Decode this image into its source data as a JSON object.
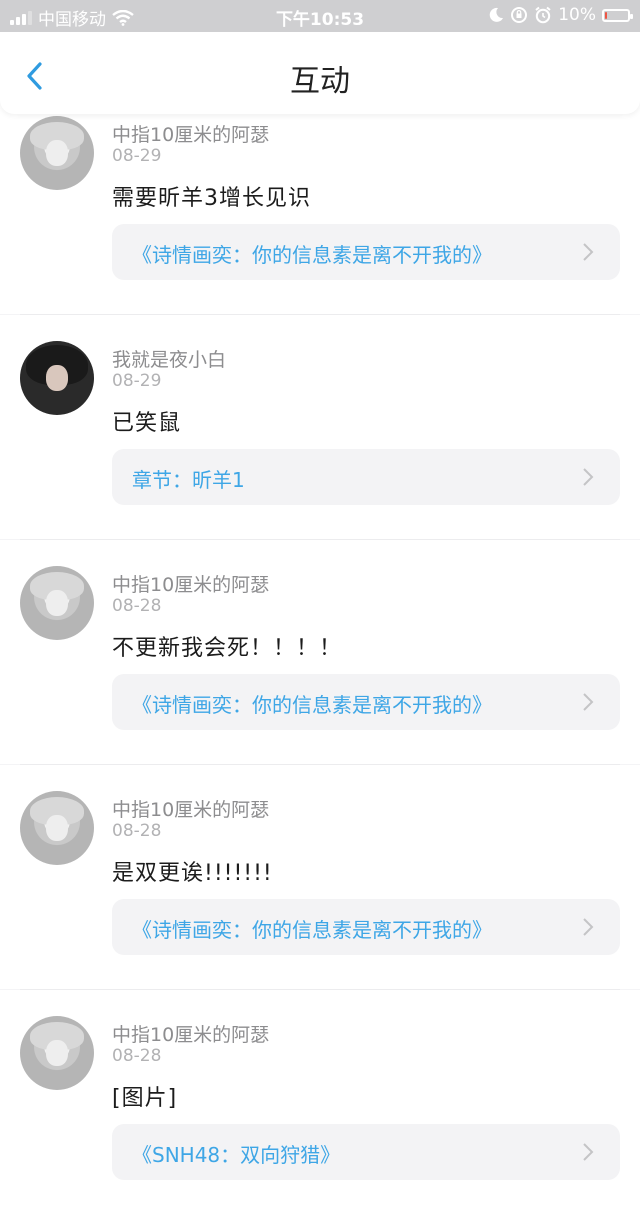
{
  "status_bar": {
    "carrier": "中国移动",
    "time": "下午10:53",
    "battery": "10%",
    "battery_level": 0.1
  },
  "nav": {
    "title": "互动",
    "back_icon": "chevron-left-icon"
  },
  "items": [
    {
      "name": "中指10厘米的阿瑟",
      "date": "08-29",
      "content": "需要昕羊3增长见识",
      "link": "《诗情画奕：你的信息素是离不开我的》"
    },
    {
      "name": "我就是夜小白",
      "date": "08-29",
      "content": "已笑鼠",
      "link": "章节：昕羊1"
    },
    {
      "name": "中指10厘米的阿瑟",
      "date": "08-28",
      "content": "不更新我会死！！！！",
      "link": "《诗情画奕：你的信息素是离不开我的》"
    },
    {
      "name": "中指10厘米的阿瑟",
      "date": "08-28",
      "content": "是双更诶!!!!!!!",
      "link": "《诗情画奕：你的信息素是离不开我的》"
    },
    {
      "name": "中指10厘米的阿瑟",
      "date": "08-28",
      "content": "[图片]",
      "link": "《SNH48：双向狩猎》"
    }
  ],
  "colors": {
    "accent": "#3ea6e6",
    "status_bar_bg": "#cfcfd1",
    "page_bg": "#f4f4f6"
  }
}
